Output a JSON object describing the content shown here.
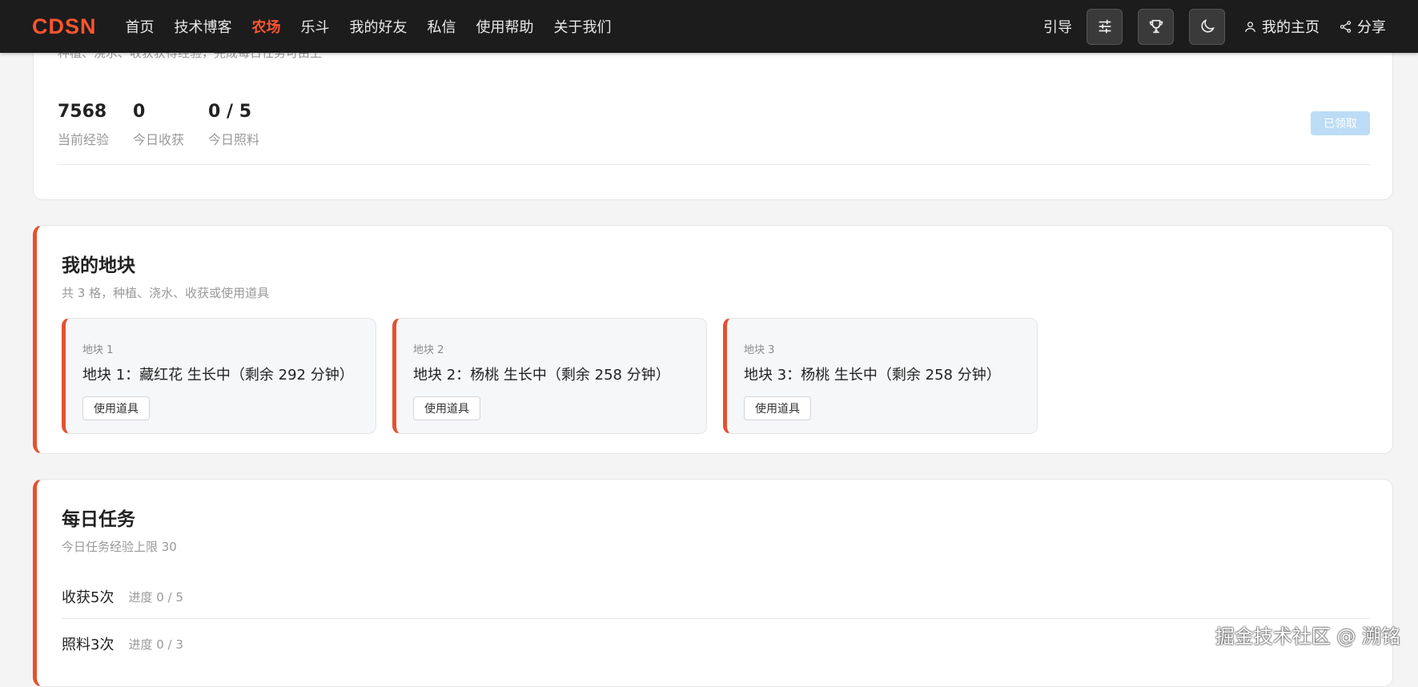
{
  "nav": {
    "logo": "CDSN",
    "items": [
      "首页",
      "技术博客",
      "农场",
      "乐斗",
      "我的好友",
      "私信",
      "使用帮助",
      "关于我们"
    ],
    "active_index": 2,
    "guide": "引导",
    "icons": [
      "sliders-icon",
      "trophy-icon",
      "moon-icon"
    ],
    "my_home": "我的主页",
    "share": "分享"
  },
  "summary": {
    "cut_text": "种植、浇水、收获获得经验，完成每日任务可由上",
    "stats": [
      {
        "value": "7568",
        "label": "当前经验"
      },
      {
        "value": "0",
        "label": "今日收获"
      },
      {
        "value": "0 / 5",
        "label": "今日照料"
      }
    ],
    "claimed_label": "已领取"
  },
  "plots_section": {
    "title": "我的地块",
    "subtitle": "共 3 格，种植、浇水、收获或使用道具",
    "plots": [
      {
        "tag": "地块 1",
        "status": "地块 1：藏红花 生长中（剩余 292 分钟）",
        "button": "使用道具"
      },
      {
        "tag": "地块 2",
        "status": "地块 2：杨桃 生长中（剩余 258 分钟）",
        "button": "使用道具"
      },
      {
        "tag": "地块 3",
        "status": "地块 3：杨桃 生长中（剩余 258 分钟）",
        "button": "使用道具"
      }
    ]
  },
  "tasks_section": {
    "title": "每日任务",
    "subtitle": "今日任务经验上限 30",
    "tasks": [
      {
        "name": "收获5次",
        "progress": "进度 0 / 5"
      },
      {
        "name": "照料3次",
        "progress": "进度 0 / 3"
      }
    ]
  },
  "watermark": "掘金技术社区 @ 溯铭",
  "colors": {
    "accent": "#fc5531",
    "bar_accent": "#e2532f",
    "nav_bg": "#1c1c1c",
    "claimed_bg": "#bcdcf5"
  }
}
